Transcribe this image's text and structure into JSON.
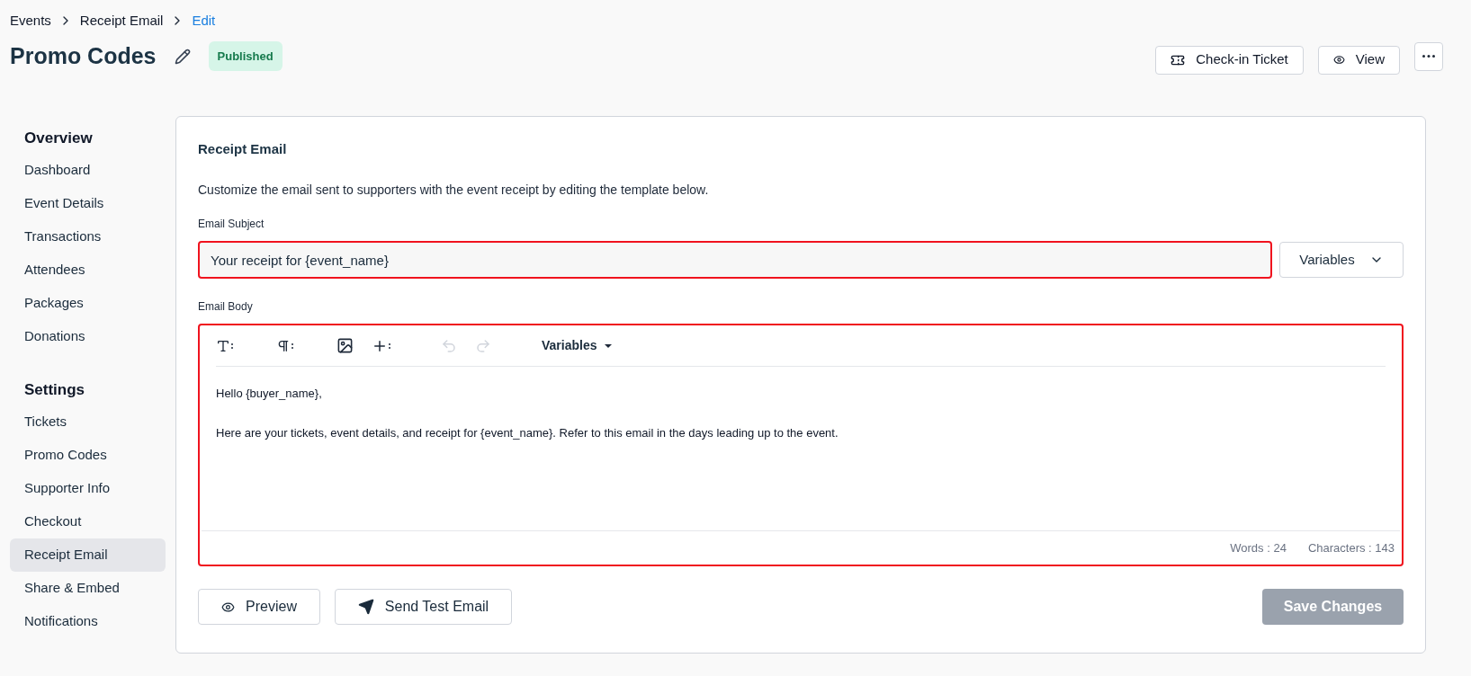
{
  "breadcrumb": [
    {
      "label": "Events",
      "current": false
    },
    {
      "label": "Receipt Email",
      "current": false
    },
    {
      "label": "Edit",
      "current": true
    }
  ],
  "header": {
    "title": "Promo Codes",
    "status": "Published",
    "actions": [
      {
        "kind": "ticket",
        "label": "Check-in Ticket"
      },
      {
        "kind": "view",
        "label": "View"
      }
    ]
  },
  "sidebar": {
    "sections": [
      {
        "heading": "Overview",
        "items": [
          {
            "label": "Dashboard",
            "selected": false
          },
          {
            "label": "Event Details",
            "selected": false
          },
          {
            "label": "Transactions",
            "selected": false
          },
          {
            "label": "Attendees",
            "selected": false
          },
          {
            "label": "Packages",
            "selected": false
          },
          {
            "label": "Donations",
            "selected": false
          }
        ]
      },
      {
        "heading": "Settings",
        "items": [
          {
            "label": "Tickets",
            "selected": false
          },
          {
            "label": "Promo Codes",
            "selected": false
          },
          {
            "label": "Supporter Info",
            "selected": false
          },
          {
            "label": "Checkout",
            "selected": false
          },
          {
            "label": "Receipt Email",
            "selected": true
          },
          {
            "label": "Share & Embed",
            "selected": false
          },
          {
            "label": "Notifications",
            "selected": false
          }
        ]
      }
    ]
  },
  "card": {
    "title": "Receipt Email",
    "description": "Customize the email sent to supporters with the event receipt by editing the template below.",
    "subject": {
      "label": "Email Subject",
      "value": "Your receipt for {event_name}",
      "invalid": true,
      "variables_label": "Variables"
    },
    "body": {
      "label": "Email Body",
      "invalid": true,
      "toolbar": [
        {
          "kind": "format",
          "disabled": false
        },
        {
          "kind": "paragraph",
          "disabled": false
        },
        {
          "kind": "image",
          "disabled": false
        },
        {
          "kind": "insert",
          "disabled": false
        },
        {
          "kind": "undo",
          "disabled": true
        },
        {
          "kind": "redo",
          "disabled": true
        }
      ],
      "variables_label": "Variables",
      "paragraphs": [
        "Hello {buyer_name},",
        "Here are your tickets, event details, and receipt for {event_name}. Refer to this email in the days leading up to the event."
      ],
      "words": "Words : 24",
      "characters": "Characters : 143"
    },
    "buttons": [
      {
        "kind": "preview",
        "label": "Preview"
      },
      {
        "kind": "send",
        "label": "Send Test Email"
      }
    ],
    "save": {
      "label": "Save Changes",
      "disabled": true
    }
  }
}
